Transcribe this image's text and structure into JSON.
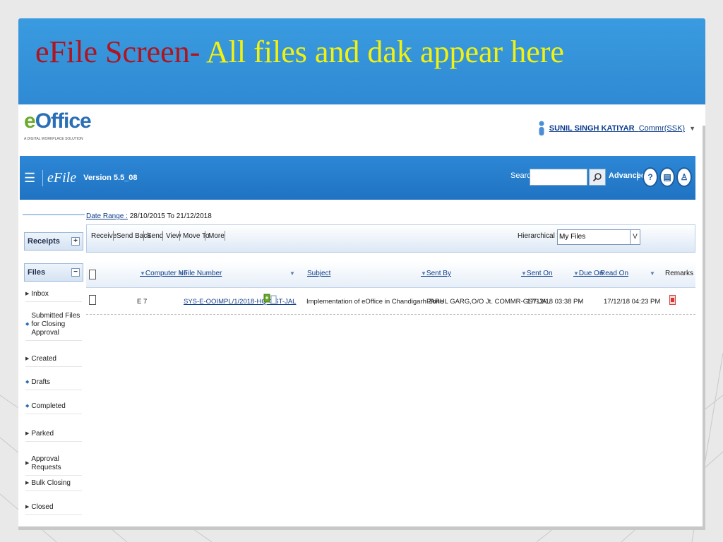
{
  "slide": {
    "title_part1": "eFile Screen-",
    "title_part2": " All files and dak appear here"
  },
  "app": {
    "logo_text": "Office",
    "logo_e": "e",
    "logo_tagline": "A DIGITAL WORKPLACE SOLUTION",
    "user_name": "SUNIL SINGH KATIYAR",
    "user_role": "Commr(SSK)",
    "brand": "eFile",
    "version": "Version 5.5_08",
    "search_label": "Search",
    "search_value": "",
    "advanced_label": "Advanced",
    "pipe": "|"
  },
  "sidebar": {
    "receipts_label": "Receipts",
    "receipts_toggle": "+",
    "files_label": "Files",
    "files_toggle": "−",
    "items": [
      {
        "label": "Inbox",
        "marker": "arrow"
      },
      {
        "label": "Submitted Files for Closing Approval",
        "marker": "dot"
      },
      {
        "label": "Created",
        "marker": "arrow"
      },
      {
        "label": "Drafts",
        "marker": "dot"
      },
      {
        "label": "Completed",
        "marker": "dot"
      },
      {
        "label": "Parked",
        "marker": "arrow"
      },
      {
        "label": "Approval Requests",
        "marker": "arrow"
      },
      {
        "label": "Bulk Closing",
        "marker": "arrow"
      },
      {
        "label": "Closed",
        "marker": "arrow"
      }
    ]
  },
  "main": {
    "date_range_label": "Date Range :",
    "date_range_value": "28/10/2015 To 21/12/2018",
    "actions": [
      "Receive",
      "Send Back",
      "Send",
      "View",
      "Move To",
      "More"
    ],
    "hier_label": "Hierarchical View",
    "hier_value": "My Files",
    "hier_caret": "V"
  },
  "table": {
    "headers": {
      "computer_no": "Computer No",
      "file_number": "File Number",
      "subject": "Subject",
      "sent_by": "Sent By",
      "sent_on": "Sent On",
      "due_on": "Due On",
      "read_on": "Read On",
      "remarks": "Remarks"
    },
    "rows": [
      {
        "computer_no": "E 7",
        "file_number": "SYS-E-OOIMPL/1/2018-HQ-GST-JAL",
        "subject": "Implementation of eOffice in Chandigarh Zone",
        "sent_by": "PARUL GARG,O/O Jt. COMMR-GST-JAL",
        "sent_on": "17/12/18 03:38 PM",
        "due_on": "-",
        "read_on": "17/12/18 04:23 PM"
      }
    ]
  }
}
